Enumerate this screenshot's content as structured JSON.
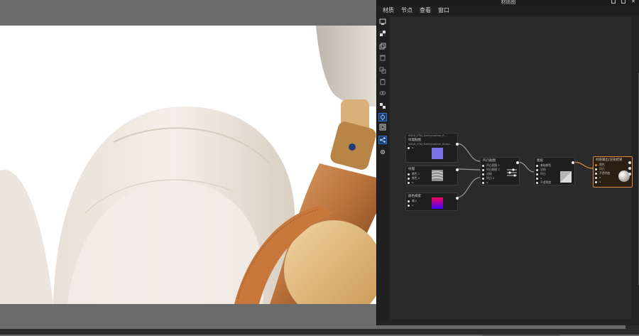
{
  "material_editor": {
    "window_title": "材质图",
    "menu": [
      "材质",
      "节点",
      "查看",
      "窗口"
    ],
    "nodes": {
      "texture": {
        "header": "WB18_ETW_EarthyLeather_R...",
        "title": "纹理贴图",
        "subtitle": "WB18_ETW_EarthyLeather_Bump...",
        "ports": [
          "u"
        ]
      },
      "noise": {
        "title": "纹理",
        "ports": [
          "颜色 1",
          "颜色 2",
          "u"
        ]
      },
      "gradient": {
        "title": "颜色梯度",
        "ports": [
          "输入",
          "u"
        ]
      },
      "mix": {
        "title": "凹凸贴图",
        "ports": [
          "凹凸贴图 1",
          "凹凸贴图 2",
          "法线",
          "凹凸 2",
          "u"
        ]
      },
      "layer": {
        "title": "图层",
        "ports": [
          "基础颜色",
          "法线",
          "凹凸",
          "u",
          "不透明度"
        ]
      },
      "output": {
        "title": "材质输出/渲染结果",
        "ports": [
          "颜色",
          "凹凸",
          "不透明度",
          "u",
          "u"
        ]
      }
    },
    "colors": {
      "accent_selected": "#d98a3a",
      "swatch_blue": "#7b74e6",
      "gradient_start": "#ff0060",
      "gradient_end": "#3a00ff"
    },
    "toolbar_icons": [
      "render-icon",
      "checker-icon",
      "copy-icon",
      "delete-icon",
      "duplicate-icon",
      "paste-icon",
      "link-icon",
      "arrange-icon",
      "focus-icon",
      "fit-icon",
      "connect-icon",
      "settings-icon"
    ]
  }
}
